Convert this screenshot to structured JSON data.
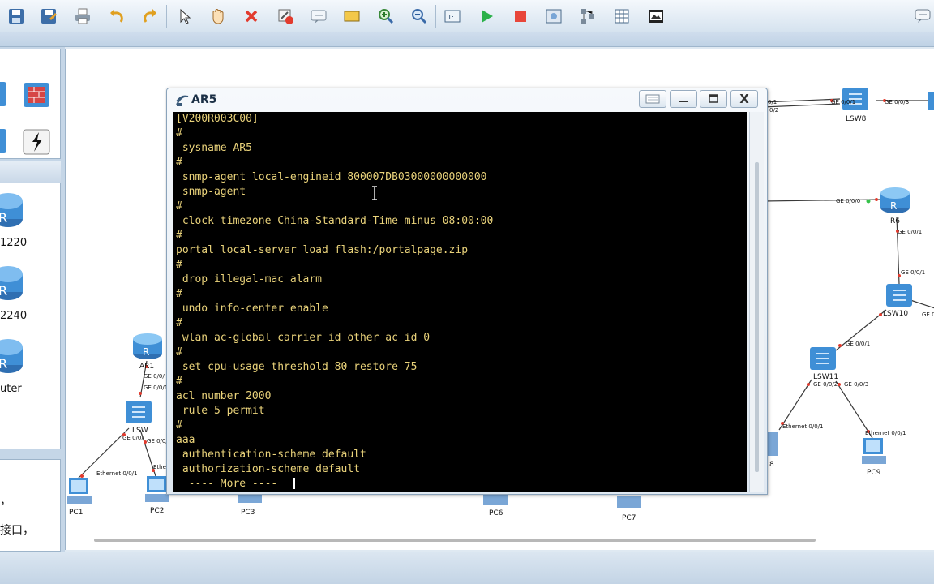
{
  "window": {
    "title": "AR5",
    "buttons": [
      "restore-down",
      "minimize",
      "maximize",
      "close"
    ],
    "close_glyph": "X"
  },
  "terminal": {
    "lines": [
      "[V200R003C00]",
      "#",
      " sysname AR5",
      "#",
      " snmp-agent local-engineid 800007DB03000000000000",
      " snmp-agent",
      "#",
      " clock timezone China-Standard-Time minus 08:00:00",
      "#",
      "portal local-server load flash:/portalpage.zip",
      "#",
      " drop illegal-mac alarm",
      "#",
      " undo info-center enable",
      "#",
      " wlan ac-global carrier id other ac id 0",
      "#",
      " set cpu-usage threshold 80 restore 75",
      "#",
      "acl number 2000",
      " rule 5 permit",
      "#",
      "aaa",
      " authentication-scheme default",
      " authorization-scheme default",
      "  ---- More ----"
    ]
  },
  "left_panel": {
    "device_names": [
      "1220",
      "2240",
      "uter"
    ],
    "description_lines": [
      "，",
      "接口，"
    ]
  },
  "topology": {
    "nodes": {
      "ar1": "AR1",
      "lsw_left": "LSW",
      "lsw8": "LSW8",
      "r6": "R6",
      "lsw10": "LSW10",
      "lsw11": "LSW11",
      "pc1": "PC1",
      "pc2": "PC2",
      "pc3": "PC3",
      "pc6": "PC6",
      "pc7": "PC7",
      "pc8_partial": "8",
      "pc9": "PC9"
    },
    "port_labels": {
      "ar1_p1": "GE 0/0/",
      "ar1_p2": "GE 0/0/1",
      "lsw_p1": "GE 0/0/",
      "lsw_p2": "GE 0/0/",
      "lsw_eth": "Ethernet 0/0/1",
      "lsw_eth2": "Ethe",
      "lsw8_p1": "GE 0/0/1",
      "lsw8_p2": "GE 0/0/3",
      "lsw8_p3": "0/1",
      "lsw8_p4": "0/2",
      "r6_p0": "GE 0/0/0",
      "r6_p1": "GE 0/0/1",
      "lsw10_p1": "GE 0/0/1",
      "lsw10_p2": "GE 0/0/2",
      "lsw11_p1": "GE 0/0/1",
      "lsw11_p2": "GE 0/0/2",
      "lsw11_p3": "GE 0/0/3",
      "pc8_eth": "Ethernet 0/0/1",
      "pc9_eth": "Ethernet 0/0/1"
    }
  },
  "colors": {
    "terminal_bg": "#000000",
    "terminal_text": "#e9d27a",
    "device_blue": "#3f8fd6",
    "link_line": "#3a3a3a"
  }
}
